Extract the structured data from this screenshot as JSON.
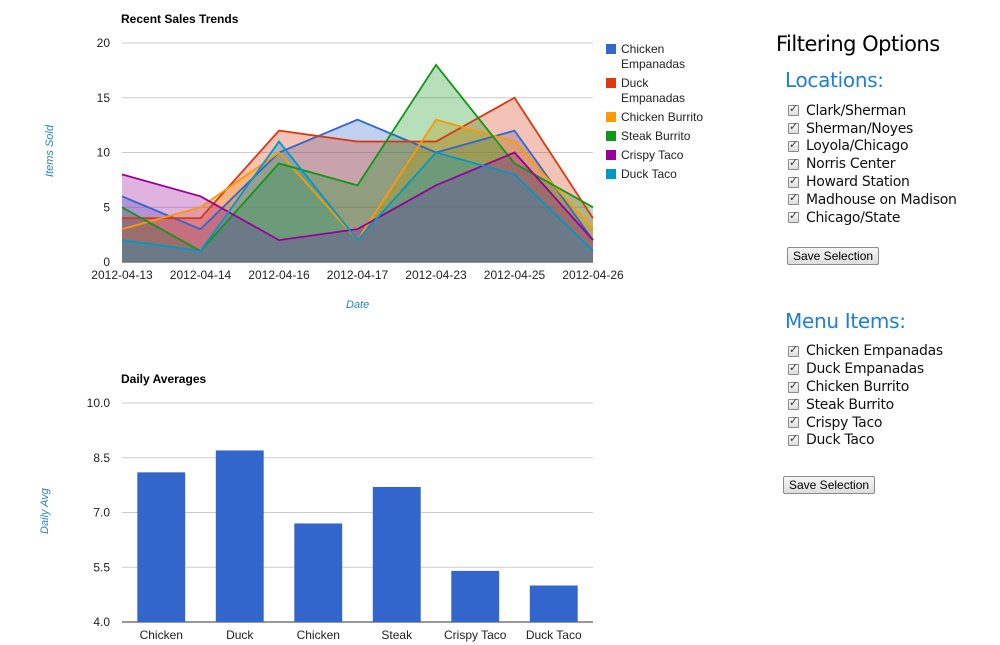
{
  "charts": {
    "trends": {
      "title": "Recent Sales Trends",
      "ylabel": "Items Sold",
      "xlabel": "Date"
    },
    "averages": {
      "title": "Daily Averages",
      "ylabel": "Daily Avg"
    }
  },
  "chart_data": [
    {
      "type": "area",
      "title": "Recent Sales Trends",
      "xlabel": "Date",
      "ylabel": "Items Sold",
      "x": [
        "2012-04-13",
        "2012-04-14",
        "2012-04-16",
        "2012-04-17",
        "2012-04-23",
        "2012-04-25",
        "2012-04-26"
      ],
      "ylim": [
        0,
        20
      ],
      "yticks": [
        "0",
        "5",
        "10",
        "15",
        "20"
      ],
      "grid": true,
      "legend": "right",
      "series": [
        {
          "name": "Chicken Empanadas",
          "color": "#3366cc",
          "values": [
            6,
            3,
            10,
            13,
            10,
            12,
            2
          ]
        },
        {
          "name": "Duck Empanadas",
          "color": "#dc3912",
          "values": [
            4,
            4,
            12,
            11,
            11,
            15,
            4
          ]
        },
        {
          "name": "Chicken Burrito",
          "color": "#ff9900",
          "values": [
            3,
            5,
            10,
            2,
            13,
            11,
            3
          ]
        },
        {
          "name": "Steak Burrito",
          "color": "#109618",
          "values": [
            5,
            1,
            9,
            7,
            18,
            9,
            5
          ]
        },
        {
          "name": "Crispy Taco",
          "color": "#990099",
          "values": [
            8,
            6,
            2,
            3,
            7,
            10,
            2
          ]
        },
        {
          "name": "Duck Taco",
          "color": "#0099c6",
          "values": [
            2,
            1,
            11,
            2,
            10,
            8,
            1
          ]
        }
      ]
    },
    {
      "type": "bar",
      "title": "Daily Averages",
      "ylabel": "Daily Avg",
      "categories": [
        "Chicken",
        "Duck",
        "Chicken",
        "Steak",
        "Crispy Taco",
        "Duck Taco"
      ],
      "values": [
        8.1,
        8.7,
        6.7,
        7.7,
        5.4,
        5.0
      ],
      "ylim": [
        4.0,
        10.0
      ],
      "yticks": [
        "4.0",
        "5.5",
        "7.0",
        "8.5",
        "10.0"
      ],
      "color": "#3366cc",
      "grid": true
    }
  ],
  "filter": {
    "title": "Filtering Options",
    "locations": {
      "title": "Locations:",
      "items": [
        "Clark/Sherman",
        "Sherman/Noyes",
        "Loyola/Chicago",
        "Norris Center",
        "Howard Station",
        "Madhouse on Madison",
        "Chicago/State"
      ],
      "save_label": "Save Selection"
    },
    "menu": {
      "title": "Menu Items:",
      "items": [
        "Chicken Empanadas",
        "Duck Empanadas",
        "Chicken Burrito",
        "Steak Burrito",
        "Crispy Taco",
        "Duck Taco"
      ],
      "save_label": "Save Selection"
    }
  }
}
